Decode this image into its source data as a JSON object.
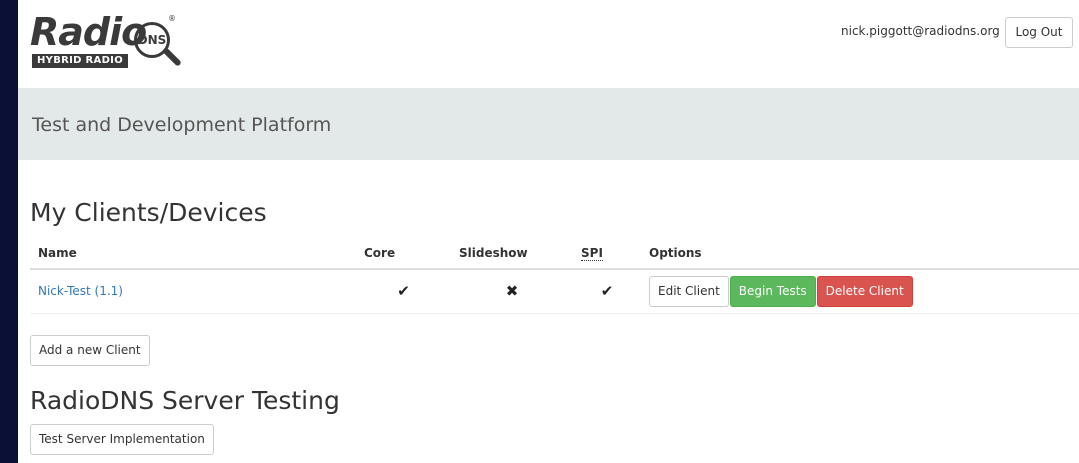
{
  "header": {
    "logo": {
      "word": "Radio",
      "dns": "DNS",
      "sub": "HYBRID RADIO",
      "reg": "®"
    },
    "user_email": "nick.piggott@radiodns.org",
    "logout_label": "Log Out"
  },
  "banner": {
    "title": "Test and Development Platform"
  },
  "clients_section": {
    "title": "My Clients/Devices",
    "columns": {
      "name": "Name",
      "core": "Core",
      "slideshow": "Slideshow",
      "spi": "SPI",
      "options": "Options"
    },
    "rows": [
      {
        "name": "Nick-Test (1.1)",
        "core": "✔",
        "slideshow": "✖",
        "spi": "✔",
        "edit_label": "Edit Client",
        "begin_label": "Begin Tests",
        "delete_label": "Delete Client"
      }
    ],
    "add_label": "Add a new Client"
  },
  "server_section": {
    "title": "RadioDNS Server Testing",
    "button_label": "Test Server Implementation"
  },
  "colors": {
    "background": "#0b1136",
    "banner": "#e3e9e8",
    "link": "#337ab7",
    "success": "#5cb85c",
    "danger": "#d9534f"
  }
}
